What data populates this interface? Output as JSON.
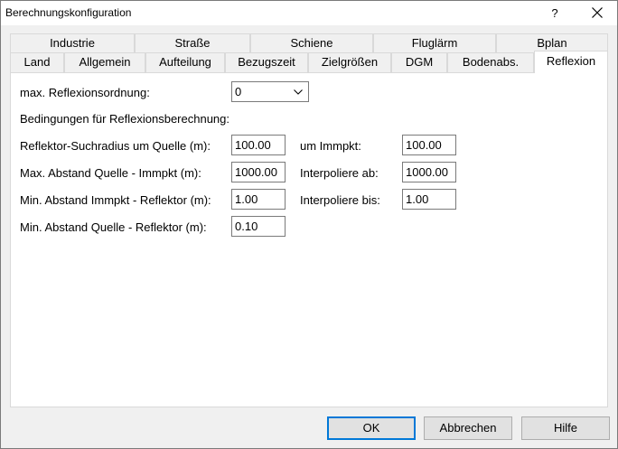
{
  "window": {
    "title": "Berechnungskonfiguration",
    "help_glyph": "?",
    "close_icon": "close-icon"
  },
  "tabs": {
    "row1": [
      "Industrie",
      "Straße",
      "Schiene",
      "Fluglärm",
      "Bplan"
    ],
    "row2": [
      "Land",
      "Allgemein",
      "Aufteilung",
      "Bezugszeit",
      "Zielgrößen",
      "DGM",
      "Bodenabs.",
      "Reflexion"
    ],
    "active": "Reflexion"
  },
  "reflexion": {
    "order_label": "max. Reflexionsordnung:",
    "order_value": "0",
    "conditions_heading": "Bedingungen für Reflexionsberechnung:",
    "rows": [
      {
        "label": "Reflektor-Suchradius um Quelle (m):",
        "value": "100.00",
        "right_label": "um Immpkt:",
        "right_value": "100.00"
      },
      {
        "label": "Max. Abstand Quelle - Immpkt (m):",
        "value": "1000.00",
        "right_label": "Interpoliere ab:",
        "right_value": "1000.00"
      },
      {
        "label": "Min. Abstand Immpkt - Reflektor (m):",
        "value": "1.00",
        "right_label": "Interpoliere bis:",
        "right_value": "1.00"
      },
      {
        "label": "Min. Abstand Quelle - Reflektor (m):",
        "value": "0.10"
      }
    ]
  },
  "buttons": {
    "ok": "OK",
    "cancel": "Abbrechen",
    "help": "Hilfe"
  },
  "colors": {
    "accent": "#0078d7",
    "dialog_bg": "#f0f0f0",
    "panel_bg": "#ffffff"
  }
}
